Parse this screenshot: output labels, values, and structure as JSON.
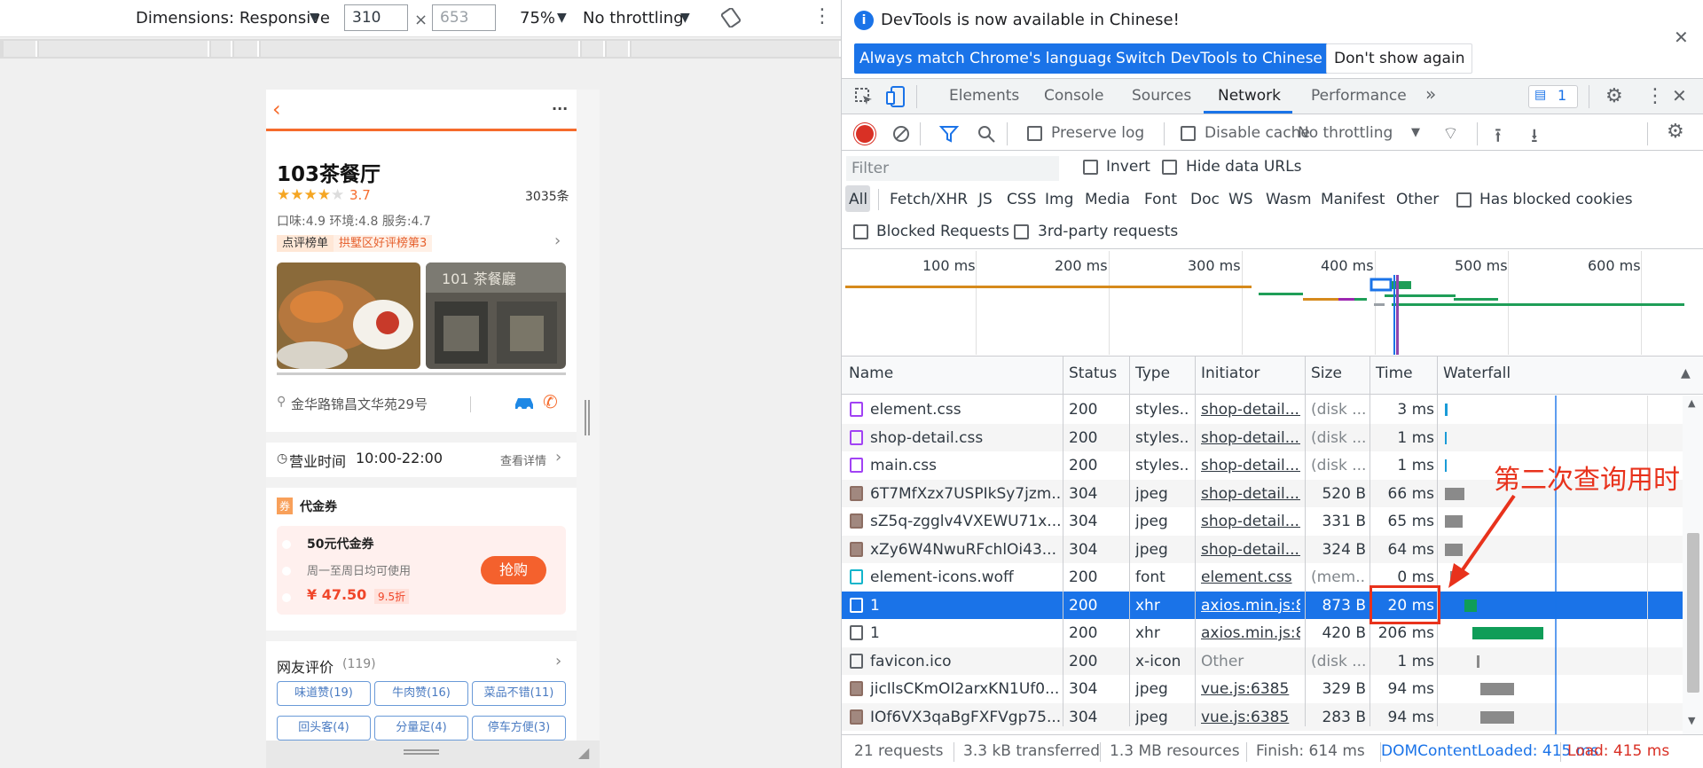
{
  "device_toolbar": {
    "dimensions_label": "Dimensions: Responsive",
    "width": "310",
    "height": "653",
    "zoom": "75%",
    "throttling": "No throttling"
  },
  "shop": {
    "back_icon": "chevron-left-icon",
    "more": "...",
    "name": "103茶餐厅",
    "rating": "3.7",
    "review_count": "3035条",
    "sub_scores": "口味:4.9 环境:4.8 服务:4.7",
    "rank_tag": "点评榜单",
    "rank_text": "拱墅区好评榜第3",
    "address": "金华路锦昌文华苑29号",
    "hours_label": "营业时间",
    "hours": "10:00-22:00",
    "hours_detail": "查看详情",
    "coupon_badge": "券",
    "coupon_section": "代金券",
    "coupon_title": "50元代金券",
    "coupon_desc": "周一至周日均可使用",
    "coupon_price": "¥ 47.50",
    "coupon_discount": "9.5折",
    "buy_button": "抢购",
    "reviews_title": "网友评价",
    "reviews_count": "(119)",
    "review_tags": [
      "味道赞(19)",
      "牛肉赞(16)",
      "菜品不错(11)",
      "回头客(4)",
      "分量足(4)",
      "停车方便(3)"
    ],
    "photo2_sign": "101 茶餐廳"
  },
  "banner": {
    "text": "DevTools is now available in Chinese!",
    "btn1": "Always match Chrome's language",
    "btn2": "Switch DevTools to Chinese",
    "btn3": "Don't show again"
  },
  "tabs": {
    "elements": "Elements",
    "console": "Console",
    "sources": "Sources",
    "network": "Network",
    "performance": "Performance",
    "more": "»",
    "issues_count": "1"
  },
  "net_toolbar": {
    "preserve_log": "Preserve log",
    "disable_cache": "Disable cache",
    "throttling": "No throttling"
  },
  "filter": {
    "placeholder": "Filter",
    "invert": "Invert",
    "hide_data_urls": "Hide data URLs",
    "types": [
      "All",
      "Fetch/XHR",
      "JS",
      "CSS",
      "Img",
      "Media",
      "Font",
      "Doc",
      "WS",
      "Wasm",
      "Manifest",
      "Other"
    ],
    "has_blocked_cookies": "Has blocked cookies",
    "blocked_requests": "Blocked Requests",
    "third_party": "3rd-party requests"
  },
  "timeline": {
    "ticks": [
      "100 ms",
      "200 ms",
      "300 ms",
      "400 ms",
      "500 ms",
      "600 ms"
    ]
  },
  "table": {
    "headers": [
      "Name",
      "Status",
      "Type",
      "Initiator",
      "Size",
      "Time",
      "Waterfall"
    ],
    "rows": [
      {
        "icon": "css",
        "name": "element.css",
        "status": "200",
        "type": "styles...",
        "initiator": "shop-detail....",
        "size": "(disk ...",
        "time": "3 ms"
      },
      {
        "icon": "css",
        "name": "shop-detail.css",
        "status": "200",
        "type": "styles...",
        "initiator": "shop-detail....",
        "size": "(disk ...",
        "time": "1 ms"
      },
      {
        "icon": "css",
        "name": "main.css",
        "status": "200",
        "type": "styles...",
        "initiator": "shop-detail....",
        "size": "(disk ...",
        "time": "1 ms"
      },
      {
        "icon": "img",
        "name": "6T7MfXzx7USPIkSy7jzm...",
        "status": "304",
        "type": "jpeg",
        "initiator": "shop-detail....",
        "size": "520 B",
        "time": "66 ms"
      },
      {
        "icon": "img",
        "name": "sZ5q-zgglv4VXEWU71x...",
        "status": "304",
        "type": "jpeg",
        "initiator": "shop-detail....",
        "size": "331 B",
        "time": "65 ms"
      },
      {
        "icon": "img",
        "name": "xZy6W4NwuRFchlOi43...",
        "status": "304",
        "type": "jpeg",
        "initiator": "shop-detail....",
        "size": "324 B",
        "time": "64 ms"
      },
      {
        "icon": "font",
        "name": "element-icons.woff",
        "status": "200",
        "type": "font",
        "initiator": "element.css",
        "size": "(mem...",
        "time": "0 ms"
      },
      {
        "icon": "doc",
        "name": "1",
        "status": "200",
        "type": "xhr",
        "initiator": "axios.min.js:8",
        "size": "873 B",
        "time": "20 ms"
      },
      {
        "icon": "doc",
        "name": "1",
        "status": "200",
        "type": "xhr",
        "initiator": "axios.min.js:8",
        "size": "420 B",
        "time": "206 ms"
      },
      {
        "icon": "doc",
        "name": "favicon.ico",
        "status": "200",
        "type": "x-icon",
        "initiator": "Other",
        "size": "(disk ...",
        "time": "1 ms"
      },
      {
        "icon": "img",
        "name": "jicIlsCKmOI2arxKN1Uf0...",
        "status": "304",
        "type": "jpeg",
        "initiator": "vue.js:6385",
        "size": "329 B",
        "time": "94 ms"
      },
      {
        "icon": "img",
        "name": "IOf6VX3qaBgFXFVgp75...",
        "status": "304",
        "type": "jpeg",
        "initiator": "vue.js:6385",
        "size": "283 B",
        "time": "94 ms"
      }
    ]
  },
  "annotation": {
    "text": "第二次查询用时"
  },
  "status": {
    "requests": "21 requests",
    "transferred": "3.3 kB transferred",
    "resources": "1.3 MB resources",
    "finish": "Finish: 614 ms",
    "dcl": "DOMContentLoaded: 415 ms",
    "load": "Load: 415 ms"
  },
  "colors": {
    "accent": "#1a73e8",
    "shop_orange": "#f66b2c",
    "annotation_red": "#e8321c",
    "selected_row": "#1a73e8"
  }
}
